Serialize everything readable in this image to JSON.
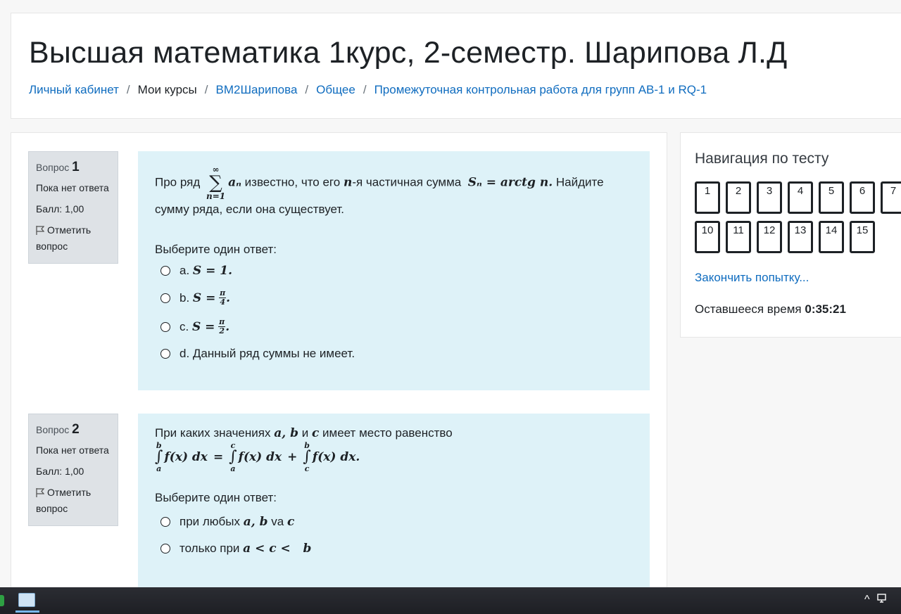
{
  "course": {
    "title": "Высшая математика 1курс, 2-семестр. Шарипова Л.Д"
  },
  "breadcrumb": [
    {
      "label": "Личный кабинет",
      "link": true
    },
    {
      "label": "Мои курсы",
      "link": false
    },
    {
      "label": "ВМ2Шарипова",
      "link": true
    },
    {
      "label": "Общее",
      "link": true
    },
    {
      "label": "Промежуточная контрольная работа для групп АВ-1 и RQ-1",
      "link": true
    }
  ],
  "breadcrumb_separator": "/",
  "questions": [
    {
      "word": "Вопрос",
      "number": "1",
      "state": "Пока нет ответа",
      "mark": "Балл: 1,00",
      "flag_label": "Отметить вопрос",
      "text_before_sum": "Про ряд",
      "sum_upper": "∞",
      "sum_sign": "∑",
      "sum_lower": "n=1",
      "sum_term": "aₙ",
      "text_middle": "известно, что его",
      "n_symbol": "n",
      "text_middle2": "-я частичная сумма",
      "formula_sn": "Sₙ = arctg n.",
      "text_after": "Найдите сумму ряда, если она существует.",
      "prompt": "Выберите один ответ:",
      "answers": [
        {
          "prefix": "a.",
          "math": "S = 1."
        },
        {
          "prefix": "b.",
          "math_lead": "S =",
          "frac_num": "π",
          "frac_den": "4",
          "trail": "."
        },
        {
          "prefix": "c.",
          "math_lead": "S =",
          "frac_num": "π",
          "frac_den": "2",
          "trail": "."
        },
        {
          "prefix": "d.",
          "text": "Данный ряд суммы не имеет."
        }
      ]
    },
    {
      "word": "Вопрос",
      "number": "2",
      "state": "Пока нет ответа",
      "mark": "Балл: 1,00",
      "flag_label": "Отметить вопрос",
      "text_before": "При каких значениях",
      "vars_ab": "a, b",
      "text_and": "и",
      "var_c": "c",
      "text_after": "имеет место равенство",
      "integrals": [
        {
          "upper": "b",
          "lower": "a",
          "body": "f(x) dx",
          "op": "="
        },
        {
          "upper": "c",
          "lower": "a",
          "body": "f(x) dx",
          "op": "+"
        },
        {
          "upper": "b",
          "lower": "c",
          "body": "f(x) dx.",
          "op": ""
        }
      ],
      "integral_sign": "∫",
      "prompt": "Выберите один ответ:",
      "answers": [
        {
          "text": "при любых",
          "math": "a, b",
          "text2": "va",
          "math2": "c"
        },
        {
          "text": "только при",
          "math": "a < c <   b"
        }
      ]
    }
  ],
  "navigation": {
    "title": "Навигация по тесту",
    "buttons": [
      "1",
      "2",
      "3",
      "4",
      "5",
      "6",
      "7",
      "10",
      "11",
      "12",
      "13",
      "14",
      "15"
    ],
    "finish_link": "Закончить попытку...",
    "time_label": "Оставшееся время",
    "time_value": "0:35:21"
  },
  "taskbar": {
    "tray_chevron": "^",
    "tray_icons": [
      "chevron-up-icon",
      "network-icon"
    ]
  },
  "colors": {
    "link": "#0f6cbf",
    "question_bg": "#def2f8",
    "info_bg": "#dee2e6"
  }
}
